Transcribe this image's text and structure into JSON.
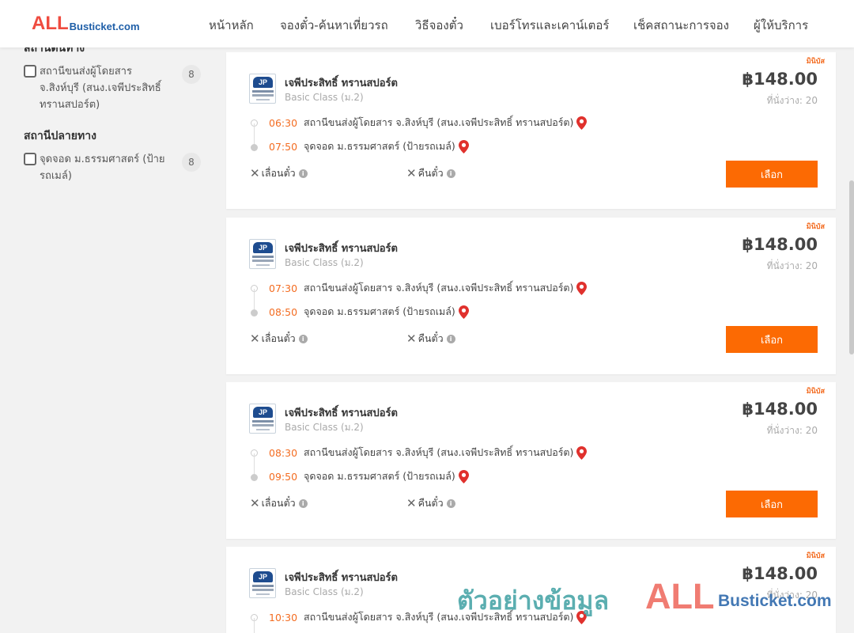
{
  "header": {
    "logo_main": "ALL",
    "logo_sub": "Busticket.com",
    "nav": [
      {
        "label": "หน้าหลัก"
      },
      {
        "label": "จองตั๋ว-ค้นหาเที่ยวรถ"
      },
      {
        "label": "วิธีจองตั๋ว"
      },
      {
        "label": "เบอร์โทรและเคาน์เตอร์"
      },
      {
        "label": "เช็คสถานะการจอง"
      },
      {
        "label": "ผู้ให้บริการ"
      }
    ]
  },
  "sidebar": {
    "origin_title": "สถานีต้นทาง",
    "origin_options": [
      {
        "label": "สถานีขนส่งผู้โดยสาร จ.สิงห์บุรี (สนง.เจพีประสิทธิ์ ทรานสปอร์ต)",
        "count": "8"
      }
    ],
    "destination_title": "สถานีปลายทาง",
    "destination_options": [
      {
        "label": "จุดจอด ม.ธรรมศาสตร์ (ป้ายรถเมล์)",
        "count": "8"
      }
    ]
  },
  "trips": [
    {
      "tag": "มินิบัส",
      "operator": "เจพีประสิทธิ์ ทรานสปอร์ต",
      "bus_class": "Basic Class (ม.2)",
      "price": "฿148.00",
      "seats": "ที่นั่งว่าง: 20",
      "depart_time": "06:30",
      "depart_place": "สถานีขนส่งผู้โดยสาร จ.สิงห์บุรี (สนง.เจพีประสิทธิ์ ทรานสปอร์ต)",
      "arrive_time": "07:50",
      "arrive_place": "จุดจอด ม.ธรรมศาสตร์ (ป้ายรถเมล์)",
      "postpone": "เลื่อนตั๋ว",
      "refund": "คืนตั๋ว",
      "select": "เลือก"
    },
    {
      "tag": "มินิบัส",
      "operator": "เจพีประสิทธิ์ ทรานสปอร์ต",
      "bus_class": "Basic Class (ม.2)",
      "price": "฿148.00",
      "seats": "ที่นั่งว่าง: 20",
      "depart_time": "07:30",
      "depart_place": "สถานีขนส่งผู้โดยสาร จ.สิงห์บุรี (สนง.เจพีประสิทธิ์ ทรานสปอร์ต)",
      "arrive_time": "08:50",
      "arrive_place": "จุดจอด ม.ธรรมศาสตร์ (ป้ายรถเมล์)",
      "postpone": "เลื่อนตั๋ว",
      "refund": "คืนตั๋ว",
      "select": "เลือก"
    },
    {
      "tag": "มินิบัส",
      "operator": "เจพีประสิทธิ์ ทรานสปอร์ต",
      "bus_class": "Basic Class (ม.2)",
      "price": "฿148.00",
      "seats": "ที่นั่งว่าง: 20",
      "depart_time": "08:30",
      "depart_place": "สถานีขนส่งผู้โดยสาร จ.สิงห์บุรี (สนง.เจพีประสิทธิ์ ทรานสปอร์ต)",
      "arrive_time": "09:50",
      "arrive_place": "จุดจอด ม.ธรรมศาสตร์ (ป้ายรถเมล์)",
      "postpone": "เลื่อนตั๋ว",
      "refund": "คืนตั๋ว",
      "select": "เลือก"
    },
    {
      "tag": "มินิบัส",
      "operator": "เจพีประสิทธิ์ ทรานสปอร์ต",
      "bus_class": "Basic Class (ม.2)",
      "price": "฿148.00",
      "seats": "ที่นั่งว่าง: 20",
      "depart_time": "10:30",
      "depart_place": "สถานีขนส่งผู้โดยสาร จ.สิงห์บุรี (สนง.เจพีประสิทธิ์ ทรานสปอร์ต)"
    }
  ],
  "watermark": {
    "thai": "ตัวอย่างข้อมูล",
    "main": "ALL",
    "sub": "Busticket.com"
  },
  "colors": {
    "accent": "#fc6a03",
    "time": "#f36c21",
    "logo_red": "#ef4b3f",
    "logo_blue": "#1f5fa8",
    "pin": "#e0312d"
  }
}
